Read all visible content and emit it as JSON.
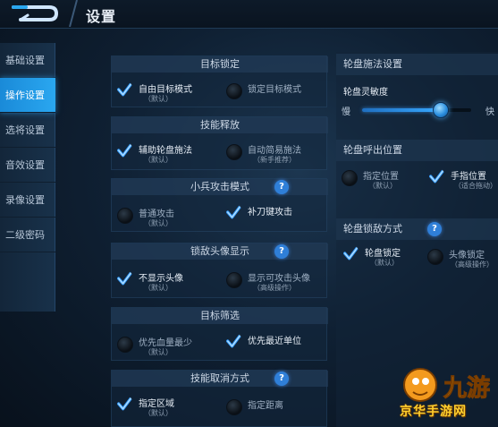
{
  "header": {
    "title": "设置"
  },
  "sidebar": {
    "items": [
      {
        "label": "基础设置",
        "active": false
      },
      {
        "label": "操作设置",
        "active": true
      },
      {
        "label": "选将设置",
        "active": false
      },
      {
        "label": "音效设置",
        "active": false
      },
      {
        "label": "录像设置",
        "active": false
      },
      {
        "label": "二级密码",
        "active": false
      }
    ]
  },
  "sections": {
    "target_lock": {
      "title": "目标锁定",
      "opt1": {
        "label": "自由目标模式",
        "sub": "（默认）",
        "checked": true
      },
      "opt2": {
        "label": "锁定目标模式",
        "checked": false
      }
    },
    "skill_cast": {
      "title": "技能释放",
      "opt1": {
        "label": "辅助轮盘施法",
        "sub": "（默认）",
        "checked": true
      },
      "opt2": {
        "label": "自动简易施法",
        "sub": "（新手推荐）",
        "checked": false
      }
    },
    "minion_attack": {
      "title": "小兵攻击模式",
      "opt1": {
        "label": "普通攻击",
        "sub": "（默认）",
        "checked": false
      },
      "opt2": {
        "label": "补刀键攻击",
        "checked": true
      },
      "help": "?"
    },
    "lock_avatar": {
      "title": "锁敌头像显示",
      "opt1": {
        "label": "不显示头像",
        "sub": "（默认）",
        "checked": true
      },
      "opt2": {
        "label": "显示可攻击头像",
        "sub": "（高级操作）",
        "checked": false
      },
      "help": "?"
    },
    "target_filter": {
      "title": "目标筛选",
      "opt1": {
        "label": "优先血量最少",
        "sub": "（默认）",
        "checked": false
      },
      "opt2": {
        "label": "优先最近单位",
        "checked": true
      }
    },
    "skill_cancel": {
      "title": "技能取消方式",
      "opt1": {
        "label": "指定区域",
        "sub": "（默认）",
        "checked": true
      },
      "opt2": {
        "label": "指定距离",
        "checked": false
      },
      "help": "?"
    }
  },
  "right": {
    "wheel_settings": {
      "title": "轮盘施法设置",
      "sensitivity_label": "轮盘灵敏度",
      "slow": "慢",
      "fast": "快",
      "value": 0.72
    },
    "wheel_position": {
      "title": "轮盘呼出位置",
      "opt1": {
        "label": "指定位置",
        "sub": "（默认）",
        "checked": false
      },
      "opt2": {
        "label": "手指位置",
        "sub": "（适合拖动）",
        "checked": true
      }
    },
    "wheel_lock": {
      "title": "轮盘锁敌方式",
      "opt1": {
        "label": "轮盘锁定",
        "sub": "（默认）",
        "checked": true
      },
      "opt2": {
        "label": "头像锁定",
        "sub": "（高级操作）",
        "checked": false
      },
      "help": "?"
    }
  },
  "watermark": {
    "text": "京华手游网"
  },
  "colors": {
    "accent": "#2aa7f0",
    "check": "#3aa0ff",
    "watermark": "#ffcf2e"
  }
}
